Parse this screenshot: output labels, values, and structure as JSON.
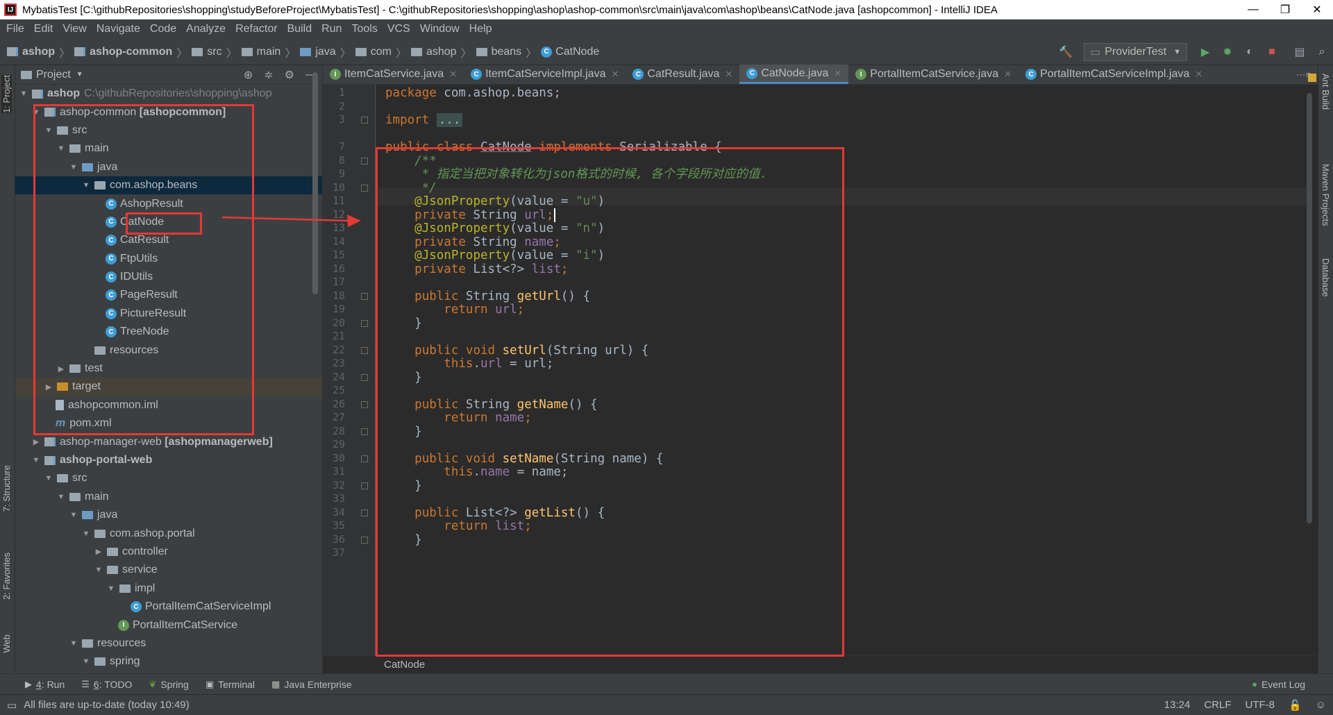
{
  "window": {
    "title": "MybatisTest [C:\\githubRepositories\\shopping\\studyBeforeProject\\MybatisTest] - C:\\githubRepositories\\shopping\\ashop\\ashop-common\\src\\main\\java\\com\\ashop\\beans\\CatNode.java [ashopcommon] - IntelliJ IDEA",
    "minimize": "—",
    "restore": "❐",
    "close": "✕"
  },
  "menu": [
    "File",
    "Edit",
    "View",
    "Navigate",
    "Code",
    "Analyze",
    "Refactor",
    "Build",
    "Run",
    "Tools",
    "VCS",
    "Window",
    "Help"
  ],
  "breadcrumbs": [
    "ashop",
    "ashop-common",
    "src",
    "main",
    "java",
    "com",
    "ashop",
    "beans",
    "CatNode"
  ],
  "run_config": "ProviderTest",
  "project_panel": {
    "title": "Project",
    "root": {
      "name": "ashop",
      "path": "C:\\githubRepositories\\shopping\\ashop"
    },
    "rows": [
      {
        "label": "ashop-common",
        "bold": "[ashopcommon]"
      },
      {
        "label": "src"
      },
      {
        "label": "main"
      },
      {
        "label": "java"
      },
      {
        "label": "com.ashop.beans"
      },
      {
        "label": "AshopResult"
      },
      {
        "label": "CatNode"
      },
      {
        "label": "CatResult"
      },
      {
        "label": "FtpUtils"
      },
      {
        "label": "IDUtils"
      },
      {
        "label": "PageResult"
      },
      {
        "label": "PictureResult"
      },
      {
        "label": "TreeNode"
      },
      {
        "label": "resources"
      },
      {
        "label": "test"
      },
      {
        "label": "target"
      },
      {
        "label": "ashopcommon.iml"
      },
      {
        "label": "pom.xml"
      },
      {
        "label": "ashop-manager-web",
        "bold": "[ashopmanagerweb]"
      },
      {
        "label": "ashop-portal-web"
      },
      {
        "label": "src"
      },
      {
        "label": "main"
      },
      {
        "label": "java"
      },
      {
        "label": "com.ashop.portal"
      },
      {
        "label": "controller"
      },
      {
        "label": "service"
      },
      {
        "label": "impl"
      },
      {
        "label": "PortalItemCatServiceImpl"
      },
      {
        "label": "PortalItemCatService"
      },
      {
        "label": "resources"
      },
      {
        "label": "spring"
      }
    ]
  },
  "tabs": [
    {
      "label": "ItemCatService.java",
      "kind": "interface"
    },
    {
      "label": "ItemCatServiceImpl.java",
      "kind": "class"
    },
    {
      "label": "CatResult.java",
      "kind": "class"
    },
    {
      "label": "CatNode.java",
      "kind": "class",
      "active": true
    },
    {
      "label": "PortalItemCatService.java",
      "kind": "interface"
    },
    {
      "label": "PortalItemCatServiceImpl.java",
      "kind": "class"
    }
  ],
  "line_numbers": [
    "1",
    "2",
    "3",
    "7",
    "8",
    "9",
    "10",
    "11",
    "12",
    "13",
    "14",
    "15",
    "16",
    "17",
    "18",
    "19",
    "20",
    "21",
    "22",
    "23",
    "24",
    "25",
    "26",
    "27",
    "28",
    "29",
    "30",
    "31",
    "32",
    "33",
    "34",
    "35",
    "36",
    "37"
  ],
  "code_text": {
    "package_kw": "package",
    "package_name": " com.ashop.beans;",
    "import_kw": "import",
    "import_fold": "...",
    "class_decl_1": "public class ",
    "class_name": "CatNode",
    "class_decl_2": " implements ",
    "class_decl_3": "Serializable {",
    "doc_open": "    /**",
    "doc_body": "     * 指定当把对象转化为json格式的时候, 各个字段所对应的值.",
    "doc_close": "     */",
    "ann": "@JsonProperty",
    "value_eq": "(value = ",
    "close_paren": ")",
    "s_u": "\"u\"",
    "s_n": "\"n\"",
    "s_i": "\"i\"",
    "private": "private",
    "public": "public",
    "return": "return",
    "this": "this",
    "void": "void",
    "string_type": " String ",
    "list_type": " List<?> ",
    "f_url": "url",
    "f_name": "name",
    "f_list": "list",
    "semi": ";",
    "m_geturl": "getUrl",
    "m_seturl": "setUrl",
    "m_getname": "getName",
    "m_setname": "setName",
    "m_getlist": "getList",
    "empty_parens_brace": "() {",
    "param_url": "(String url) {",
    "param_name": "(String name) {",
    "assign_url": " = url;",
    "assign_name": " = name;",
    "close_brace": "    }",
    "dot": "."
  },
  "editor_breadcrumb": "CatNode",
  "bottom_tools": [
    {
      "num": "4",
      "label": ": Run"
    },
    {
      "num": "6",
      "label": ": TODO"
    },
    {
      "num": "",
      "label": "Spring"
    },
    {
      "num": "",
      "label": "Terminal"
    },
    {
      "num": "",
      "label": "Java Enterprise"
    }
  ],
  "event_log": "Event Log",
  "status": {
    "message": "All files are up-to-date (today 10:49)",
    "position": "13:24",
    "line_sep": "CRLF",
    "encoding": "UTF-8"
  },
  "side_labels": {
    "project": "1: Project",
    "structure": "7: Structure",
    "favorites": "2: Favorites",
    "web": "Web",
    "ant": "Ant Build",
    "maven": "Maven Projects",
    "database": "Database"
  },
  "colors": {
    "highlight": "#e53935",
    "keyword": "#cc7832",
    "comment": "#629755",
    "annotation": "#bbb529",
    "string": "#6a8759",
    "field": "#9876aa",
    "method": "#ffc66d"
  }
}
